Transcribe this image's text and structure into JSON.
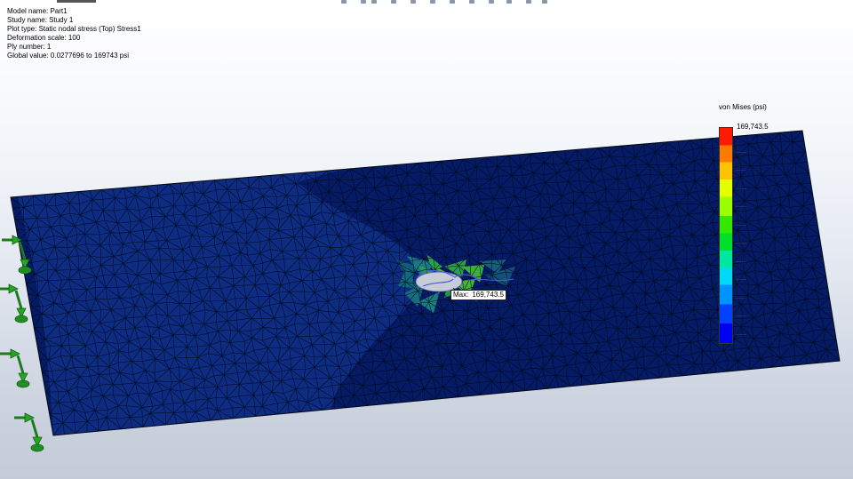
{
  "info": {
    "model_name": "Model name: Part1",
    "study_name": "Study name: Study 1",
    "plot_type": "Plot type: Static nodal stress (Top) Stress1",
    "deformation_scale": "Deformation scale: 100",
    "ply_number": "Ply number: 1",
    "global_value": "Global value: 0.0277696 to 169743 psi"
  },
  "legend": {
    "title": "von Mises (psi)",
    "max_value": "169,743.5",
    "colors": [
      "#ff1a00",
      "#ff7a00",
      "#ffc400",
      "#e5ff00",
      "#9aff00",
      "#35e800",
      "#00e02a",
      "#00e8a0",
      "#00d9f5",
      "#0092ff",
      "#0040ff",
      "#0000f0"
    ]
  },
  "annotation": {
    "max_prefix": "Max:",
    "max_value": "169,743.5"
  },
  "plate_colors": {
    "base": "#0d2c82",
    "dark": "#061b66",
    "mesh": "#000814"
  },
  "icons": {
    "fixture": "fixture-arrow-icon"
  }
}
